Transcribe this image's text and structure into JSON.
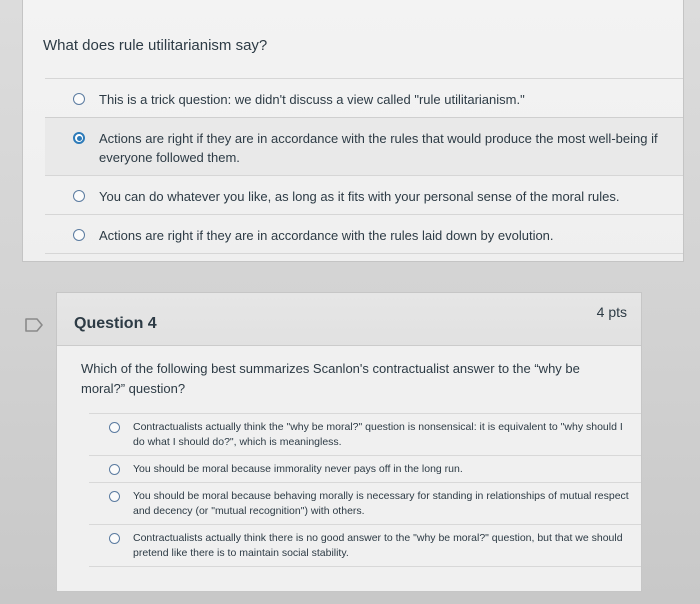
{
  "question1": {
    "text": "What does rule utilitarianism say?",
    "answers": [
      {
        "label": "This is a trick question: we didn't discuss a view called \"rule utilitarianism.\"",
        "selected": false
      },
      {
        "label": "Actions are right if they are in accordance with the rules that would produce the most well-being if everyone followed them.",
        "selected": true
      },
      {
        "label": "You can do whatever you like, as long as it fits with your personal sense of the moral rules.",
        "selected": false
      },
      {
        "label": "Actions are right if they are in accordance with the rules laid down by evolution.",
        "selected": false
      }
    ]
  },
  "question2": {
    "title": "Question 4",
    "points": "4 pts",
    "text": "Which of the following best summarizes Scanlon's contractualist answer to the “why be moral?” question?",
    "answers": [
      {
        "label": "Contractualists actually think the \"why be moral?\" question is nonsensical: it is equivalent to \"why should I do what I should do?\", which is meaningless.",
        "selected": false
      },
      {
        "label": "You should be moral because immorality never pays off in the long run.",
        "selected": false
      },
      {
        "label": "You should be moral because behaving morally is necessary for standing in relationships of mutual respect and decency (or \"mutual recognition\") with others.",
        "selected": false
      },
      {
        "label": "Contractualists actually think there is no good answer to the \"why be moral?\" question, but that we should pretend like there is to maintain social stability.",
        "selected": false
      }
    ]
  },
  "colors": {
    "accent": "#2d7bb9",
    "text": "#2d3b45",
    "card_bg": "#f0f0f0"
  }
}
